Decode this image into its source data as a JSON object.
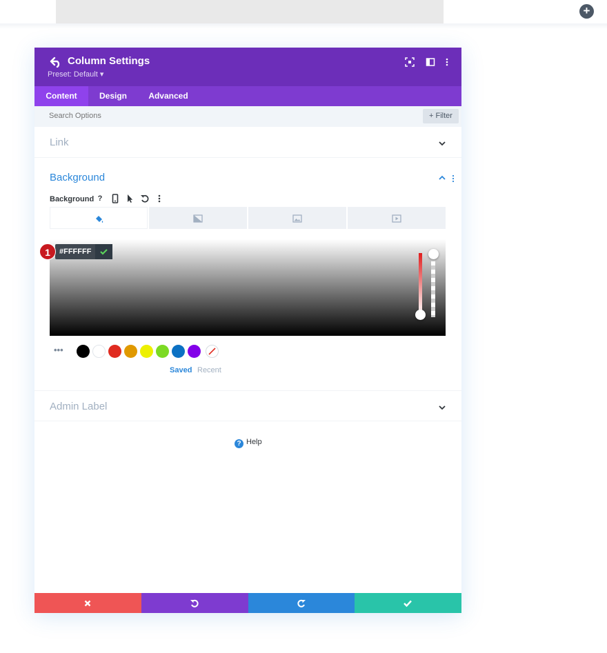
{
  "builder": {
    "add_icon": "plus-icon"
  },
  "modal": {
    "title": "Column Settings",
    "preset": "Preset: Default ▾",
    "header_icons": [
      "expand-icon",
      "sidebar-layout-icon",
      "more-vertical-icon"
    ],
    "tabs": [
      {
        "label": "Content",
        "active": true
      },
      {
        "label": "Design",
        "active": false
      },
      {
        "label": "Advanced",
        "active": false
      }
    ],
    "search": {
      "placeholder": "Search Options"
    },
    "filter_label": "+ Filter"
  },
  "sections": {
    "link": {
      "title": "Link",
      "expanded": false
    },
    "background": {
      "title": "Background",
      "expanded": true,
      "field_label": "Background",
      "option_icons": [
        "help-icon",
        "mobile-icon",
        "cursor-icon",
        "undo-icon",
        "more-vertical-icon"
      ],
      "bg_type_tabs": [
        "color-icon",
        "gradient-icon",
        "image-icon",
        "video-icon"
      ],
      "active_bg_type": "color",
      "color_picker": {
        "hex": "#FFFFFF",
        "hue_color": "#e01f1f"
      },
      "swatches": [
        "#000000",
        "#ffffff",
        "#e02b20",
        "#e09900",
        "#edf000",
        "#7cda24",
        "#0c71c3",
        "#8300e9"
      ],
      "palette_tabs": {
        "saved": "Saved",
        "recent": "Recent"
      }
    },
    "admin_label": {
      "title": "Admin Label",
      "expanded": false
    }
  },
  "annotation": {
    "step": "1"
  },
  "help": {
    "label": "Help"
  },
  "footer": {
    "buttons": [
      {
        "name": "discard",
        "icon": "close-icon",
        "color": "#ef5555"
      },
      {
        "name": "undo",
        "icon": "undo-icon",
        "color": "#7e3bd0"
      },
      {
        "name": "redo",
        "icon": "redo-icon",
        "color": "#2b87da"
      },
      {
        "name": "save",
        "icon": "check-icon",
        "color": "#29c4a9"
      }
    ]
  }
}
